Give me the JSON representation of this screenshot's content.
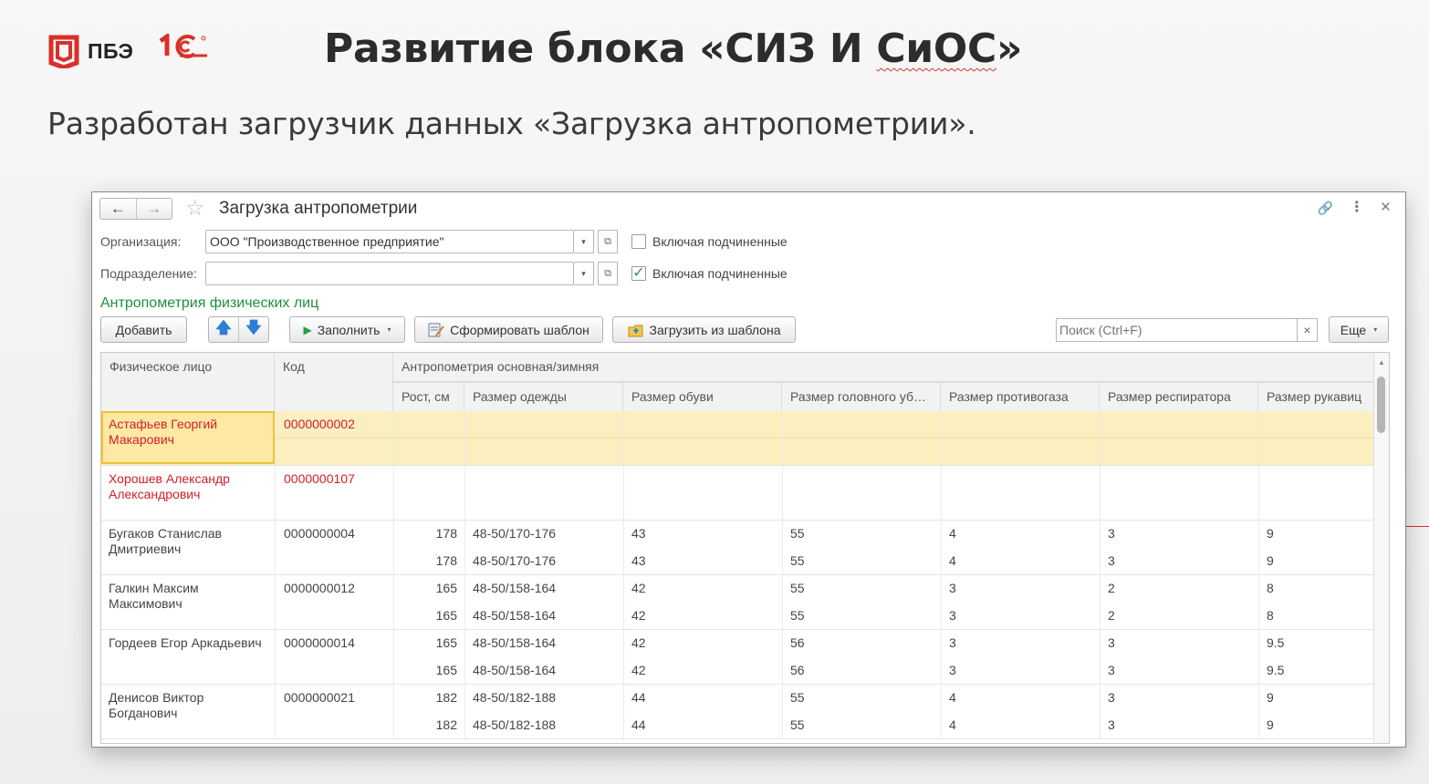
{
  "slide": {
    "logo_pbe": "ПБЭ",
    "logo_1c": "1С",
    "title_prefix": "Развитие блока «СИЗ И ",
    "title_word": "СиОС",
    "title_suffix": "»",
    "subtitle": "Разработан загрузчик данных «Загрузка антропометрии»."
  },
  "window": {
    "title": "Загрузка антропометрии",
    "back_label": "←",
    "forward_label": "→",
    "star_glyph": "☆",
    "tool_link": "🔗",
    "tool_more": "⋮",
    "tool_close": "×"
  },
  "form": {
    "org_label": "Организация:",
    "org_value": "ООО \"Производственное предприятие\"",
    "dept_label": "Подразделение:",
    "dept_value": "",
    "include_sub_label_1": "Включая подчиненные",
    "include_sub_checked_1": false,
    "include_sub_label_2": "Включая подчиненные",
    "include_sub_checked_2": true,
    "dropdown_glyph": "▾",
    "open_glyph": "⧉",
    "check_glyph": "✓"
  },
  "section": {
    "title": "Антропометрия физических лиц"
  },
  "toolbar": {
    "add": "Добавить",
    "up": "🡅",
    "down": "🡇",
    "fill": "Заполнить",
    "make_template": "Сформировать шаблон",
    "load_template": "Загрузить из шаблона",
    "search_placeholder": "Поиск (Ctrl+F)",
    "search_clear": "×",
    "more": "Еще"
  },
  "table": {
    "header_person": "Физическое лицо",
    "header_code": "Код",
    "header_group": "Антропометрия основная/зимняя",
    "columns": [
      "Рост, см",
      "Размер одежды",
      "Размер обуви",
      "Размер головного уб…",
      "Размер противогаза",
      "Размер респиратора",
      "Размер рукавиц"
    ],
    "rows": [
      {
        "name": "Астафьев Георгий Макарович",
        "code": "0000000002",
        "red": true,
        "selected": true,
        "lines": []
      },
      {
        "name": "Хорошев Александр Александрович",
        "code": "0000000107",
        "red": true,
        "selected": false,
        "lines": []
      },
      {
        "name": "Бугаков Станислав Дмитриевич",
        "code": "0000000004",
        "red": false,
        "selected": false,
        "lines": [
          [
            "178",
            "48-50/170-176",
            "43",
            "55",
            "4",
            "3",
            "9"
          ],
          [
            "178",
            "48-50/170-176",
            "43",
            "55",
            "4",
            "3",
            "9"
          ]
        ]
      },
      {
        "name": "Галкин Максим Максимович",
        "code": "0000000012",
        "red": false,
        "selected": false,
        "lines": [
          [
            "165",
            "48-50/158-164",
            "42",
            "55",
            "3",
            "2",
            "8"
          ],
          [
            "165",
            "48-50/158-164",
            "42",
            "55",
            "3",
            "2",
            "8"
          ]
        ]
      },
      {
        "name": "Гордеев Егор Аркадьевич",
        "code": "0000000014",
        "red": false,
        "selected": false,
        "lines": [
          [
            "165",
            "48-50/158-164",
            "42",
            "56",
            "3",
            "3",
            "9.5"
          ],
          [
            "165",
            "48-50/158-164",
            "42",
            "56",
            "3",
            "3",
            "9.5"
          ]
        ]
      },
      {
        "name": "Денисов Виктор Богданович",
        "code": "0000000021",
        "red": false,
        "selected": false,
        "lines": [
          [
            "182",
            "48-50/182-188",
            "44",
            "55",
            "4",
            "3",
            "9"
          ],
          [
            "182",
            "48-50/182-188",
            "44",
            "55",
            "4",
            "3",
            "9"
          ]
        ]
      }
    ]
  },
  "colors": {
    "brand_red": "#d9302a",
    "accent_green": "#1e8f3d",
    "selection": "#fbeebf",
    "error_red": "#d2202a"
  }
}
